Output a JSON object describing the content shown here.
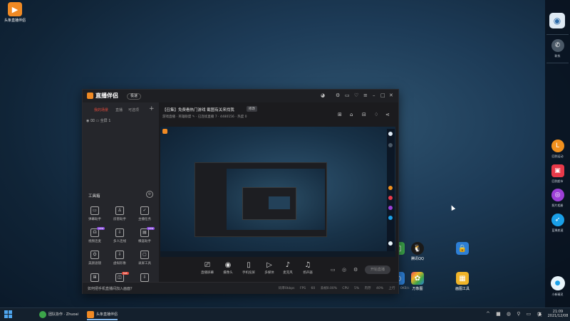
{
  "desktop": {
    "top_app_label": "头条直播伴侣",
    "shortcuts": [
      {
        "label": "",
        "color": "#3ca54a",
        "icon": "green-app-icon"
      },
      {
        "label": "腾讯QQ",
        "color": "#1a1a1a",
        "icon": "qq-penguin-icon"
      },
      {
        "label": "",
        "color": "#2d7fd6",
        "icon": "lock-icon"
      },
      {
        "label": "",
        "color": "#2d7fd6",
        "icon": "blue-app-icon"
      },
      {
        "label": "万象图",
        "color": "#e84c5a",
        "icon": "colorful-app-icon"
      },
      {
        "label": "画图工具",
        "color": "#f0b429",
        "icon": "paint-app-icon"
      }
    ]
  },
  "dock": {
    "items": [
      {
        "label": "联系",
        "color": "#4a5866",
        "icon": "phone-icon"
      },
      {
        "label": "回到运动",
        "color": "#f0901e",
        "icon": "letter-l-icon",
        "glyph": "L"
      },
      {
        "label": "回到超市",
        "color": "#e83a4a",
        "icon": "shopping-bag-icon",
        "glyph": "▣"
      },
      {
        "label": "照片相册",
        "color": "#9c3fd6",
        "icon": "circle-gallery-icon",
        "glyph": "◎"
      },
      {
        "label": "蓝果航速",
        "color": "#1aa0e8",
        "icon": "feather-icon",
        "glyph": "➶"
      },
      {
        "label": "小新精灵",
        "color": "#e8f4fa",
        "icon": "assistant-icon",
        "glyph": "●"
      }
    ]
  },
  "window": {
    "logo": "直播伴侣",
    "version": "极速",
    "left_tabs": [
      "我的场景",
      "直播",
      "可选项"
    ],
    "scene_label": "全屏 1",
    "tools_title": "工具箱",
    "tools": [
      {
        "label": "弹幕助手",
        "glyph": "▭"
      },
      {
        "label": "房管助手",
        "glyph": "♙"
      },
      {
        "label": "主播任务",
        "glyph": "✓"
      },
      {
        "label": "视频连麦",
        "glyph": "☊",
        "badge": "new"
      },
      {
        "label": "多人连线",
        "glyph": "⇩"
      },
      {
        "label": "横竖助手",
        "glyph": "▤",
        "badge": "new"
      },
      {
        "label": "美颜滤镜",
        "glyph": "⛭"
      },
      {
        "label": "虚拟形象",
        "glyph": "⇩"
      },
      {
        "label": "录屏工具",
        "glyph": "▢"
      },
      {
        "label": "",
        "glyph": "⊞"
      },
      {
        "label": "",
        "glyph": "◫",
        "badge": "hot"
      },
      {
        "label": "",
        "glyph": "⇩"
      }
    ],
    "header_title": "【召集】免费看热门游戏 截图有关来找我",
    "header_edit": "修改",
    "header_sub": "游戏直播 · 英雄联盟 ✎ · 已连续直播 7 · 4480156 · 热度 0",
    "bottom_tools": [
      {
        "label": "直播屏幕",
        "glyph": "⎚"
      },
      {
        "label": "摄像头",
        "glyph": "◉"
      },
      {
        "label": "手机投屏",
        "glyph": "▯"
      },
      {
        "label": "多媒体",
        "glyph": "▷"
      },
      {
        "label": "麦克风",
        "glyph": "♪"
      },
      {
        "label": "扬声器",
        "glyph": "♫"
      }
    ],
    "go_live": "开始直播",
    "status_msg": "如何把手机直播间加入画面？",
    "status_stats": "码率0kbps FPS 60 丢帧0.00% CPU 5% 内存 40% 上行 0KB/s"
  },
  "taskbar": {
    "tasks": [
      {
        "label": "团队协作 · Zhuoai",
        "color": "#3ca54a",
        "active": false
      },
      {
        "label": "头条直播伴侣",
        "color": "#f08a24",
        "active": true
      }
    ],
    "tray": "^ ■ ◍ ⚲ ▭ ◑",
    "lang": "英",
    "time": "21:09",
    "date": "2021/12/08"
  }
}
